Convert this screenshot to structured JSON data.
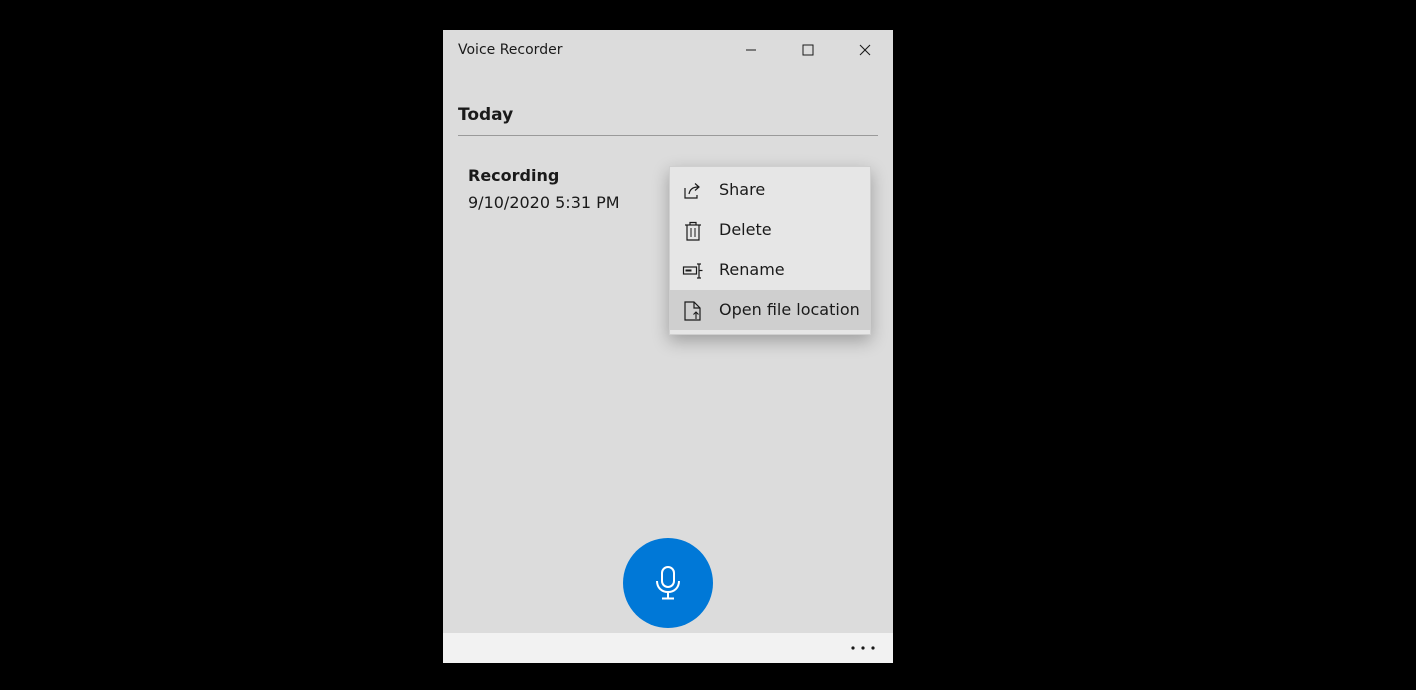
{
  "window": {
    "title": "Voice Recorder"
  },
  "list": {
    "section_header": "Today",
    "recordings": [
      {
        "name": "Recording",
        "date": "9/10/2020 5:31 PM"
      }
    ]
  },
  "context_menu": {
    "items": [
      {
        "label": "Share",
        "icon": "share-icon"
      },
      {
        "label": "Delete",
        "icon": "trash-icon"
      },
      {
        "label": "Rename",
        "icon": "rename-icon"
      },
      {
        "label": "Open file location",
        "icon": "file-location-icon"
      }
    ],
    "highlighted_item": "Open file location"
  },
  "record_button": {
    "icon": "microphone-icon"
  },
  "bottom_bar": {
    "more_icon": "more-icon"
  },
  "colors": {
    "accent": "#0078d7",
    "window_bg": "#dcdcdc",
    "menu_bg": "#e6e6e6",
    "menu_hover": "#cfcfcf",
    "bottom_bar_bg": "#f2f2f2"
  }
}
